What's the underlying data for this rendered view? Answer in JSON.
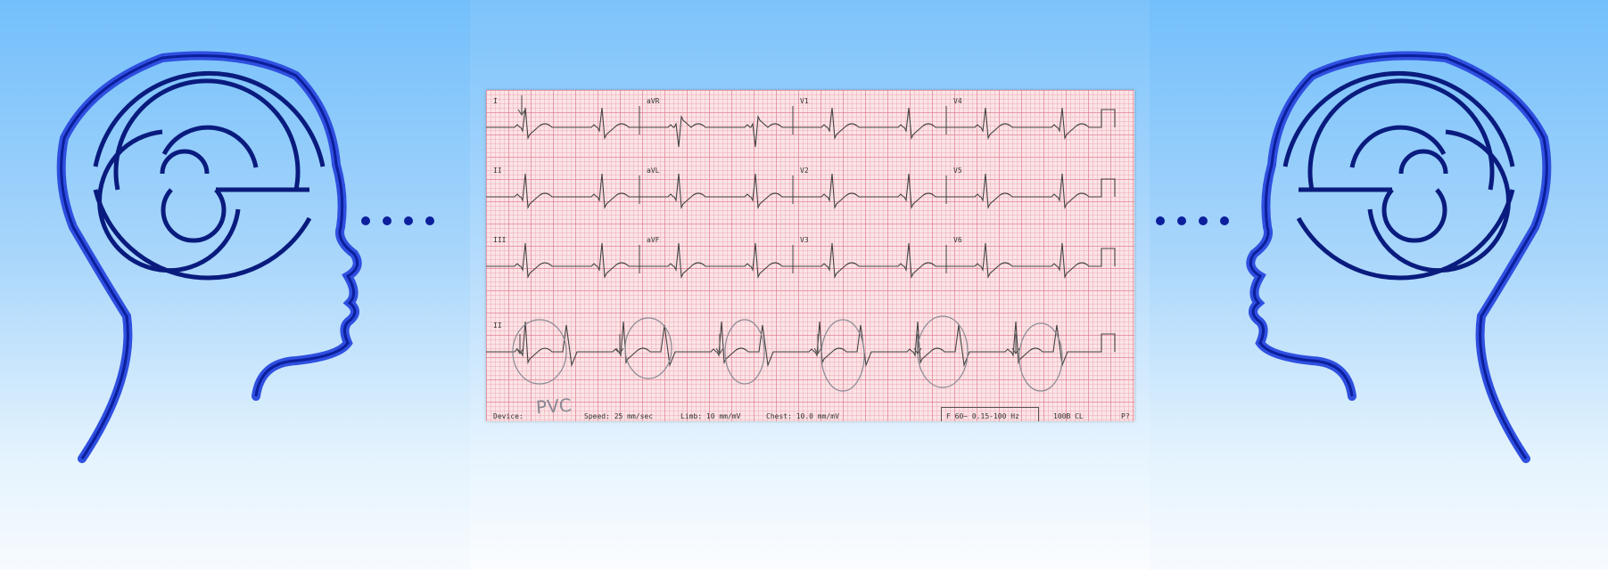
{
  "ecg": {
    "leads": [
      "I",
      "aVR",
      "V1",
      "V4",
      "II",
      "aVL",
      "V2",
      "V5",
      "III",
      "aVF",
      "V3",
      "V6",
      "II"
    ],
    "footer": {
      "device": "Device:",
      "speed": "Speed: 25 mm/sec",
      "limb": "Limb: 10 mm/mV",
      "chest": "Chest: 10.0 mm/mV",
      "filter": "F 60~ 0.15-100 Hz",
      "code": "100B CL",
      "edge": "P?"
    },
    "handwritten_note": "PVC"
  },
  "colors": {
    "head_outline": "#0c1f9c",
    "head_shadow": "#2f4fe0",
    "maze": "#0a1b7e",
    "ecg_grid": "#e3889a",
    "trace": "#444444",
    "annotation": "#8a8a95"
  },
  "icons": [
    "head-maze-icon",
    "dots-icon",
    "arrow-icon",
    "circle-annotation"
  ]
}
